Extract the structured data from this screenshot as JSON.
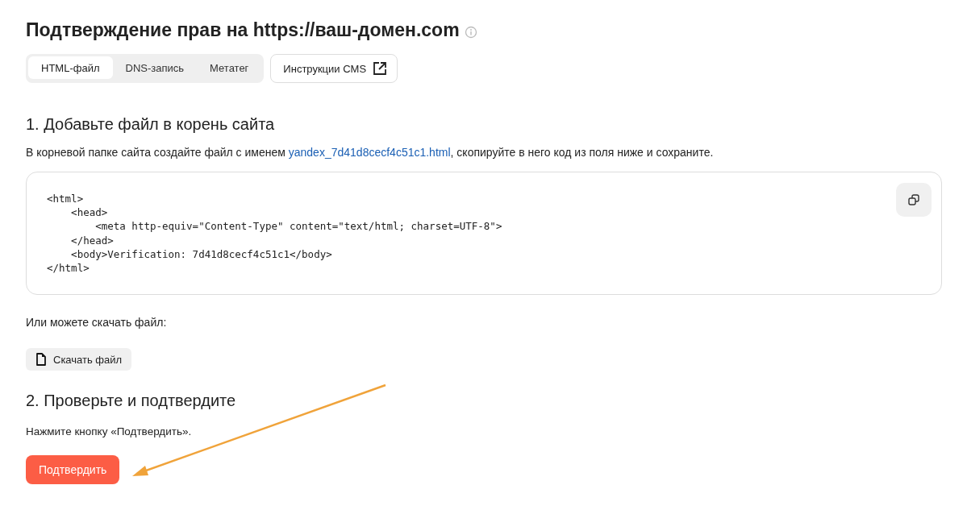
{
  "title": "Подтверждение прав на https://ваш-домен.com",
  "tabs": [
    {
      "label": "HTML-файл",
      "selected": true
    },
    {
      "label": "DNS-запись",
      "selected": false
    },
    {
      "label": "Метатег",
      "selected": false
    }
  ],
  "cms_button": "Инструкции CMS",
  "step1": {
    "heading": "1. Добавьте файл в корень сайта",
    "text_before": "В корневой папке сайта создайте файл с именем",
    "file_link": "yandex_7d41d8cecf4c51c1.html",
    "text_after": ", скопируйте в него код из поля ниже и сохраните.",
    "code_lines": [
      "<html>",
      "    <head>",
      "        <meta http-equiv=\"Content-Type\" content=\"text/html; charset=UTF-8\">",
      "    </head>",
      "    <body>Verification: 7d41d8cecf4c51c1</body>",
      "</html>"
    ],
    "download_hint": "Или можете скачать файл:",
    "download_button": "Скачать файл"
  },
  "step2": {
    "heading": "2. Проверьте и подтвердите",
    "text": "Нажмите кнопку «Подтвердить».",
    "confirm_button": "Подтвердить"
  }
}
